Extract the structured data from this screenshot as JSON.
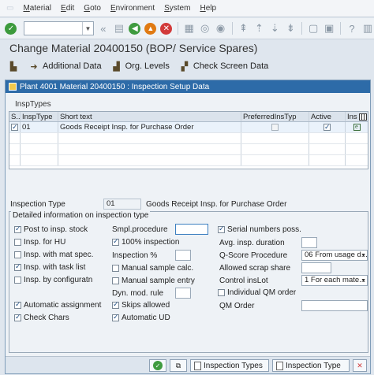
{
  "menu": {
    "items": [
      {
        "accel": "M",
        "rest": "aterial"
      },
      {
        "accel": "E",
        "rest": "dit"
      },
      {
        "accel": "G",
        "rest": "oto"
      },
      {
        "accel": "E",
        "rest": "nvironment"
      },
      {
        "accel": "S",
        "rest": "ystem"
      },
      {
        "accel": "H",
        "rest": "elp"
      }
    ]
  },
  "page_title": "Change Material 20400150 (BOP/ Service Spares)",
  "app_toolbar": {
    "additional_data": "Additional Data",
    "org_levels": "Org. Levels",
    "check_screen_data": "Check Screen Data"
  },
  "dialog": {
    "title": "Plant 4001 Material 20400150 : Inspection Setup Data",
    "insp_types_label": "InspTypes",
    "table": {
      "headers": [
        "S...",
        "InspType",
        "Short text",
        "PreferredInsTyp",
        "Active",
        "Ins"
      ],
      "rows": [
        {
          "insp_type": "01",
          "short_text": "Goods Receipt Insp. for Purchase Order",
          "preferred": false,
          "active": true
        }
      ]
    },
    "inspection_type_label": "Inspection Type",
    "inspection_type_value": "01",
    "inspection_type_text": "Goods Receipt Insp. for Purchase Order",
    "detail_frame_label": "Detailed information on inspection type",
    "col1": [
      {
        "label": "Post to insp. stock",
        "checked": true
      },
      {
        "label": "Insp. for HU",
        "checked": false
      },
      {
        "label": "Insp. with mat spec.",
        "checked": false
      },
      {
        "label": "Insp. with task list",
        "checked": true
      },
      {
        "label": "Insp. by configuratn",
        "checked": false
      },
      {
        "label": "Automatic assignment",
        "checked": true
      },
      {
        "label": "Check Chars",
        "checked": true
      }
    ],
    "col2": {
      "smpl_procedure_label": "Smpl.procedure",
      "smpl_procedure_value": "",
      "inspection_100_label": "100% inspection",
      "inspection_100_checked": true,
      "inspection_pct_label": "Inspection %",
      "inspection_pct_value": "",
      "manual_sample_calc_label": "Manual sample calc.",
      "manual_sample_calc_checked": false,
      "manual_sample_entry_label": "Manual sample entry",
      "manual_sample_entry_checked": false,
      "dyn_mod_rule_label": "Dyn. mod. rule",
      "dyn_mod_rule_value": "",
      "skips_allowed_label": "Skips allowed",
      "skips_allowed_checked": true,
      "automatic_ud_label": "Automatic UD",
      "automatic_ud_checked": true
    },
    "col3": {
      "serial_numbers_label": "Serial numbers poss.",
      "serial_numbers_checked": true,
      "avg_insp_duration_label": "Avg. insp. duration",
      "avg_insp_duration_value": "",
      "qscore_procedure_label": "Q-Score Procedure",
      "qscore_procedure_value": "06 From usage d...",
      "allowed_scrap_share_label": "Allowed scrap share",
      "allowed_scrap_share_value": "",
      "control_inslot_label": "Control insLot",
      "control_inslot_value": "1 For each mate...",
      "individual_qm_order_label": "Individual QM order",
      "individual_qm_order_checked": false,
      "qm_order_label": "QM Order",
      "qm_order_value": ""
    },
    "bottom": {
      "inspection_types": "Inspection Types",
      "inspection_type": "Inspection Type"
    }
  }
}
